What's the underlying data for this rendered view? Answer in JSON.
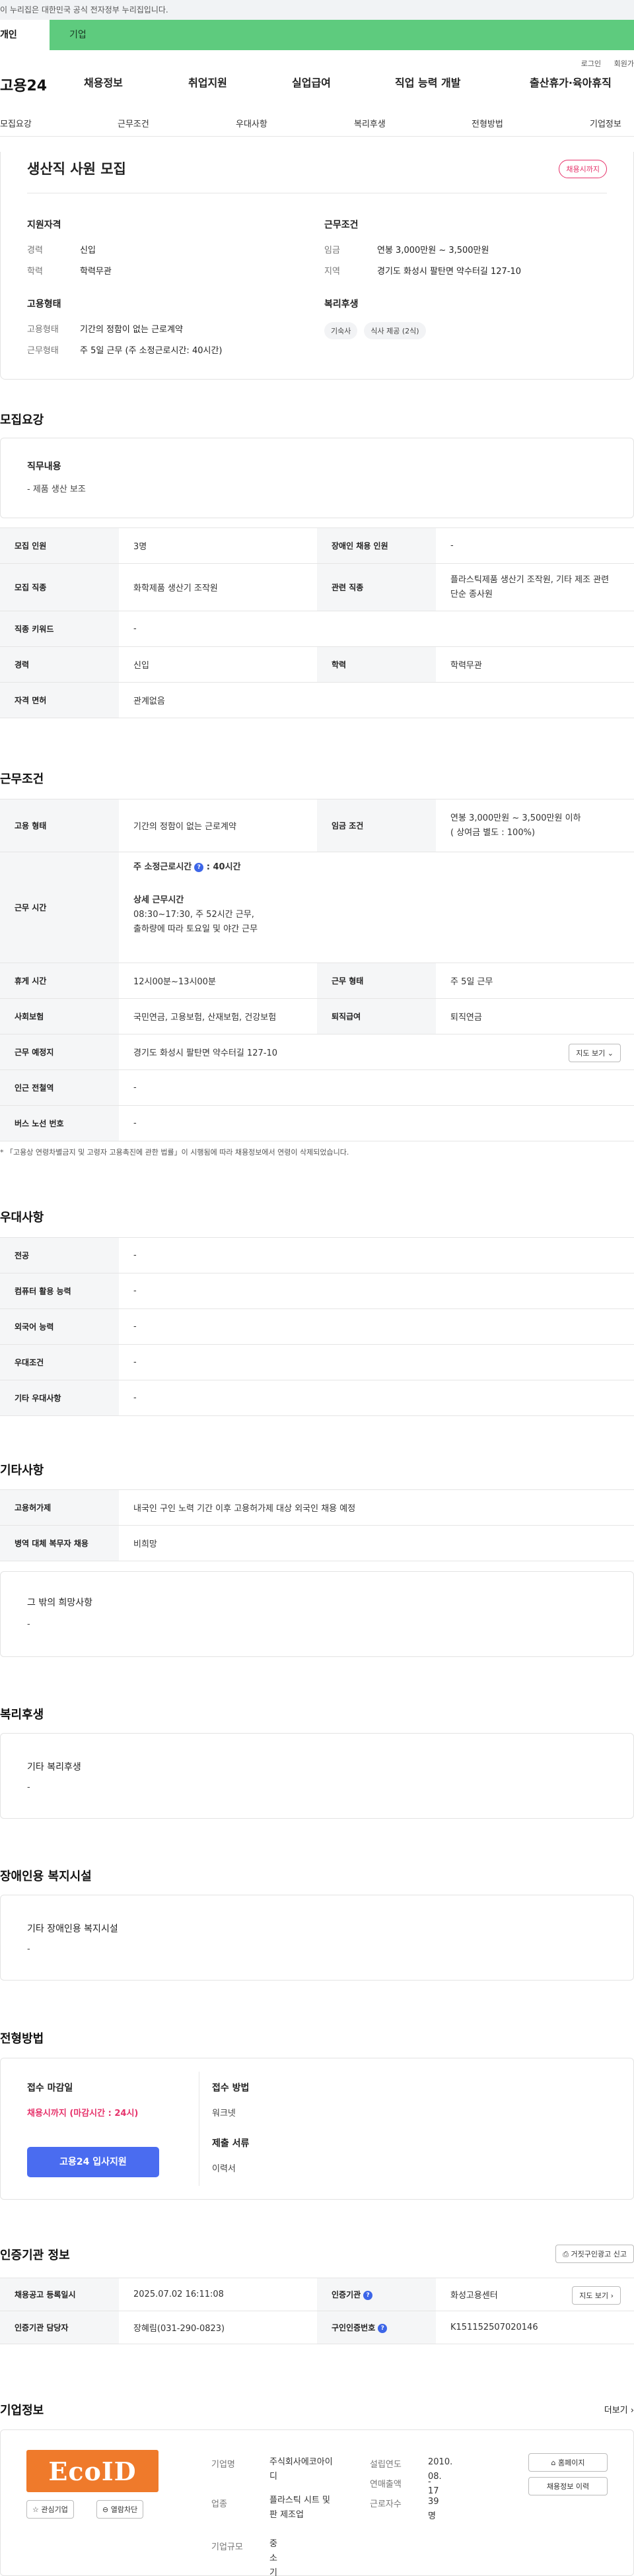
{
  "gov_banner": "이 누리집은 대한민국 공식 전자정부 누리집입니다.",
  "user_tabs": {
    "personal": "개인",
    "company": "기업"
  },
  "header": {
    "logo": "고용24",
    "menu": [
      "채용정보",
      "취업지원",
      "실업급여",
      "직업 능력 개발",
      "출산휴가·육아휴직"
    ],
    "util": [
      "로그인",
      "회원가"
    ]
  },
  "subnav": [
    "모집요강",
    "근무조건",
    "우대사항",
    "복리후생",
    "전형방법",
    "기업정보"
  ],
  "summary": {
    "title": "생산직 사원 모집",
    "badge": "채용시까지",
    "qualification": {
      "heading": "지원자격",
      "career_k": "경력",
      "career_v": "신입",
      "edu_k": "학력",
      "edu_v": "학력무관"
    },
    "conditions": {
      "heading": "근무조건",
      "pay_k": "임금",
      "pay_v": "연봉 3,000만원 ~ 3,500만원",
      "area_k": "지역",
      "area_v": "경기도 화성시 팔탄면 약수터길 127-10"
    },
    "employment": {
      "heading": "고용형태",
      "type_k": "고용형태",
      "type_v": "기간의 정함이 없는 근로계약",
      "shape_k": "근무형태",
      "shape_v": "주 5일 근무 (주 소정근로시간: 40시간)"
    },
    "welfare": {
      "heading": "복리후생",
      "chips": [
        "기숙사",
        "식사 제공 (2식)"
      ]
    }
  },
  "recruit": {
    "section_title": "모집요강",
    "duty_title": "직무내용",
    "duty_value": "-  제품 생산 보조",
    "rows": {
      "headcount_k": "모집 인원",
      "headcount_v": "3명",
      "disabled_k": "장애인 채용 인원",
      "disabled_v": "-",
      "job_k": "모집 직종",
      "job_v": "화학제품 생산기 조작원",
      "related_k": "관련 직종",
      "related_v": "플라스틱제품 생산기 조작원, 기타 제조 관련 단순 종사원",
      "keyword_k": "직종 키워드",
      "keyword_v": "-",
      "career_k": "경력",
      "career_v": "신입",
      "edu_k": "학력",
      "edu_v": "학력무관",
      "license_k": "자격 면허",
      "license_v": "관계없음"
    }
  },
  "work": {
    "section_title": "근무조건",
    "type_k": "고용 형태",
    "type_v": "기간의 정함이 없는 근로계약",
    "wage_k": "임금 조건",
    "wage_v1": "연봉 3,000만원 ~ 3,500만원 이하",
    "wage_v2": "( 상여금 별도 : 100%)",
    "hours_k": "근무 시간",
    "hours_std_label": "주 소정근로시간",
    "hours_std_val": "40시간",
    "hours_detail_label": "상세 근무시간",
    "hours_detail_1": "08:30~17:30, 주 52시간 근무,",
    "hours_detail_2": "출하량에 따라 토요일 및 야간 근무",
    "break_k": "휴게 시간",
    "break_v": "12시00분~13시00분",
    "shape_k": "근무 형태",
    "shape_v": "주 5일 근무",
    "insure_k": "사회보험",
    "insure_v": "국민연금, 고용보험, 산재보험, 건강보험",
    "retire_k": "퇴직급여",
    "retire_v": "퇴직연금",
    "place_k": "근무 예정지",
    "place_v": "경기도 화성시 팔탄면 약수터길 127-10",
    "map_btn": "지도 보기",
    "subway_k": "인근 전철역",
    "subway_v": "-",
    "bus_k": "버스 노선 번호",
    "bus_v": "-",
    "note": "* 「고용상 연령차별금지 및 고령자 고용촉진에 관한 법률」이 시행됨에 따라 채용정보에서 연령이 삭제되었습니다."
  },
  "pref": {
    "section_title": "우대사항",
    "major_k": "전공",
    "major_v": "-",
    "computer_k": "컴퓨터 활용 능력",
    "computer_v": "-",
    "lang_k": "외국어 능력",
    "lang_v": "-",
    "cond_k": "우대조건",
    "cond_v": "-",
    "etc_k": "기타 우대사항",
    "etc_v": "-"
  },
  "etc": {
    "section_title": "기타사항",
    "foreign_k": "고용허가제",
    "foreign_v": "내국인 구인 노력 기간 이후 고용허가제 대상 외국인 채용 예정",
    "military_k": "병역 대체 복무자 채용",
    "military_v": "비희망",
    "other_title": "그 밖의 희망사항",
    "other_v": "-"
  },
  "welfare": {
    "section_title": "복리후생",
    "title": "기타 복리후생",
    "value": "-"
  },
  "disability": {
    "section_title": "장애인용 복지시설",
    "title": "기타 장애인용 복지시설",
    "value": "-"
  },
  "selection": {
    "section_title": "전형방법",
    "deadline_k": "접수 마감일",
    "deadline_v": "채용시까지 (마감시간 : 24시)",
    "method_k": "접수 방법",
    "method_v": "워크넷",
    "apply_btn": "고용24 입사지원",
    "docs_k": "제출 서류",
    "docs_v": "이력서"
  },
  "agency": {
    "section_title": "인증기관 정보",
    "report_btn": "거짓구인광고 신고",
    "reg_k": "채용공고 등록일시",
    "reg_v": "2025.07.02 16:11:08",
    "org_k": "인증기관",
    "org_v": "화성고용센터",
    "map_btn": "지도 보기",
    "staff_k": "인증기관 담당자",
    "staff_v": "장혜림(031-290-0823)",
    "no_k": "구인인증번호",
    "no_v": "K151152507020146"
  },
  "company": {
    "section_title": "기업정보",
    "more": "더보기",
    "logo_text": "EcoID",
    "fav_btn": "관심기업",
    "block_btn": "열람차단",
    "name_k": "기업명",
    "name_v1": "주식회사에코아이",
    "name_v2": "디",
    "industry_k": "업종",
    "industry_v1": "플라스틱 시트 및",
    "industry_v2": "판 제조업",
    "size_k": "기업규모",
    "size_v": "중소기업",
    "founded_k": "설립연도",
    "founded_v": "2010. 08. 17",
    "sales_k": "연매출액",
    "sales_v": "-",
    "staff_k": "근로자수",
    "staff_v": "39명",
    "home_btn": "홈페이지",
    "history_btn": "채용정보 이력"
  }
}
